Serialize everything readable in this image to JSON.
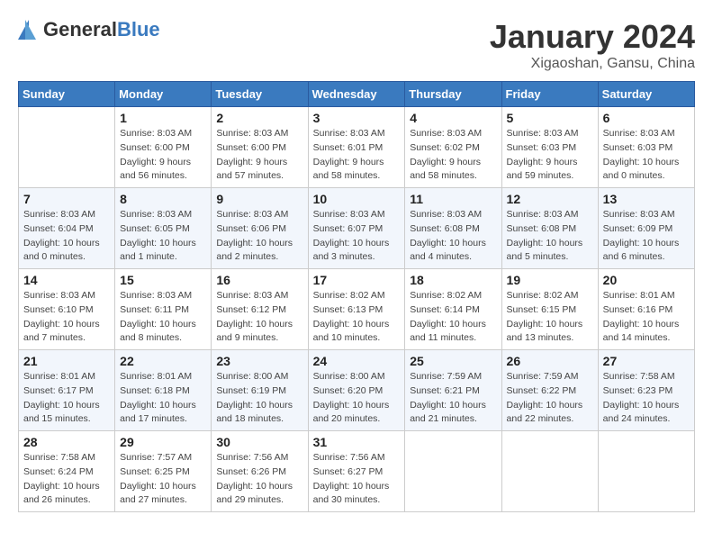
{
  "header": {
    "logo_general": "General",
    "logo_blue": "Blue",
    "month_title": "January 2024",
    "location": "Xigaoshan, Gansu, China"
  },
  "days_of_week": [
    "Sunday",
    "Monday",
    "Tuesday",
    "Wednesday",
    "Thursday",
    "Friday",
    "Saturday"
  ],
  "weeks": [
    [
      {
        "day": "",
        "info": ""
      },
      {
        "day": "1",
        "info": "Sunrise: 8:03 AM\nSunset: 6:00 PM\nDaylight: 9 hours\nand 56 minutes."
      },
      {
        "day": "2",
        "info": "Sunrise: 8:03 AM\nSunset: 6:00 PM\nDaylight: 9 hours\nand 57 minutes."
      },
      {
        "day": "3",
        "info": "Sunrise: 8:03 AM\nSunset: 6:01 PM\nDaylight: 9 hours\nand 58 minutes."
      },
      {
        "day": "4",
        "info": "Sunrise: 8:03 AM\nSunset: 6:02 PM\nDaylight: 9 hours\nand 58 minutes."
      },
      {
        "day": "5",
        "info": "Sunrise: 8:03 AM\nSunset: 6:03 PM\nDaylight: 9 hours\nand 59 minutes."
      },
      {
        "day": "6",
        "info": "Sunrise: 8:03 AM\nSunset: 6:03 PM\nDaylight: 10 hours\nand 0 minutes."
      }
    ],
    [
      {
        "day": "7",
        "info": "Sunrise: 8:03 AM\nSunset: 6:04 PM\nDaylight: 10 hours\nand 0 minutes."
      },
      {
        "day": "8",
        "info": "Sunrise: 8:03 AM\nSunset: 6:05 PM\nDaylight: 10 hours\nand 1 minute."
      },
      {
        "day": "9",
        "info": "Sunrise: 8:03 AM\nSunset: 6:06 PM\nDaylight: 10 hours\nand 2 minutes."
      },
      {
        "day": "10",
        "info": "Sunrise: 8:03 AM\nSunset: 6:07 PM\nDaylight: 10 hours\nand 3 minutes."
      },
      {
        "day": "11",
        "info": "Sunrise: 8:03 AM\nSunset: 6:08 PM\nDaylight: 10 hours\nand 4 minutes."
      },
      {
        "day": "12",
        "info": "Sunrise: 8:03 AM\nSunset: 6:08 PM\nDaylight: 10 hours\nand 5 minutes."
      },
      {
        "day": "13",
        "info": "Sunrise: 8:03 AM\nSunset: 6:09 PM\nDaylight: 10 hours\nand 6 minutes."
      }
    ],
    [
      {
        "day": "14",
        "info": "Sunrise: 8:03 AM\nSunset: 6:10 PM\nDaylight: 10 hours\nand 7 minutes."
      },
      {
        "day": "15",
        "info": "Sunrise: 8:03 AM\nSunset: 6:11 PM\nDaylight: 10 hours\nand 8 minutes."
      },
      {
        "day": "16",
        "info": "Sunrise: 8:03 AM\nSunset: 6:12 PM\nDaylight: 10 hours\nand 9 minutes."
      },
      {
        "day": "17",
        "info": "Sunrise: 8:02 AM\nSunset: 6:13 PM\nDaylight: 10 hours\nand 10 minutes."
      },
      {
        "day": "18",
        "info": "Sunrise: 8:02 AM\nSunset: 6:14 PM\nDaylight: 10 hours\nand 11 minutes."
      },
      {
        "day": "19",
        "info": "Sunrise: 8:02 AM\nSunset: 6:15 PM\nDaylight: 10 hours\nand 13 minutes."
      },
      {
        "day": "20",
        "info": "Sunrise: 8:01 AM\nSunset: 6:16 PM\nDaylight: 10 hours\nand 14 minutes."
      }
    ],
    [
      {
        "day": "21",
        "info": "Sunrise: 8:01 AM\nSunset: 6:17 PM\nDaylight: 10 hours\nand 15 minutes."
      },
      {
        "day": "22",
        "info": "Sunrise: 8:01 AM\nSunset: 6:18 PM\nDaylight: 10 hours\nand 17 minutes."
      },
      {
        "day": "23",
        "info": "Sunrise: 8:00 AM\nSunset: 6:19 PM\nDaylight: 10 hours\nand 18 minutes."
      },
      {
        "day": "24",
        "info": "Sunrise: 8:00 AM\nSunset: 6:20 PM\nDaylight: 10 hours\nand 20 minutes."
      },
      {
        "day": "25",
        "info": "Sunrise: 7:59 AM\nSunset: 6:21 PM\nDaylight: 10 hours\nand 21 minutes."
      },
      {
        "day": "26",
        "info": "Sunrise: 7:59 AM\nSunset: 6:22 PM\nDaylight: 10 hours\nand 22 minutes."
      },
      {
        "day": "27",
        "info": "Sunrise: 7:58 AM\nSunset: 6:23 PM\nDaylight: 10 hours\nand 24 minutes."
      }
    ],
    [
      {
        "day": "28",
        "info": "Sunrise: 7:58 AM\nSunset: 6:24 PM\nDaylight: 10 hours\nand 26 minutes."
      },
      {
        "day": "29",
        "info": "Sunrise: 7:57 AM\nSunset: 6:25 PM\nDaylight: 10 hours\nand 27 minutes."
      },
      {
        "day": "30",
        "info": "Sunrise: 7:56 AM\nSunset: 6:26 PM\nDaylight: 10 hours\nand 29 minutes."
      },
      {
        "day": "31",
        "info": "Sunrise: 7:56 AM\nSunset: 6:27 PM\nDaylight: 10 hours\nand 30 minutes."
      },
      {
        "day": "",
        "info": ""
      },
      {
        "day": "",
        "info": ""
      },
      {
        "day": "",
        "info": ""
      }
    ]
  ]
}
